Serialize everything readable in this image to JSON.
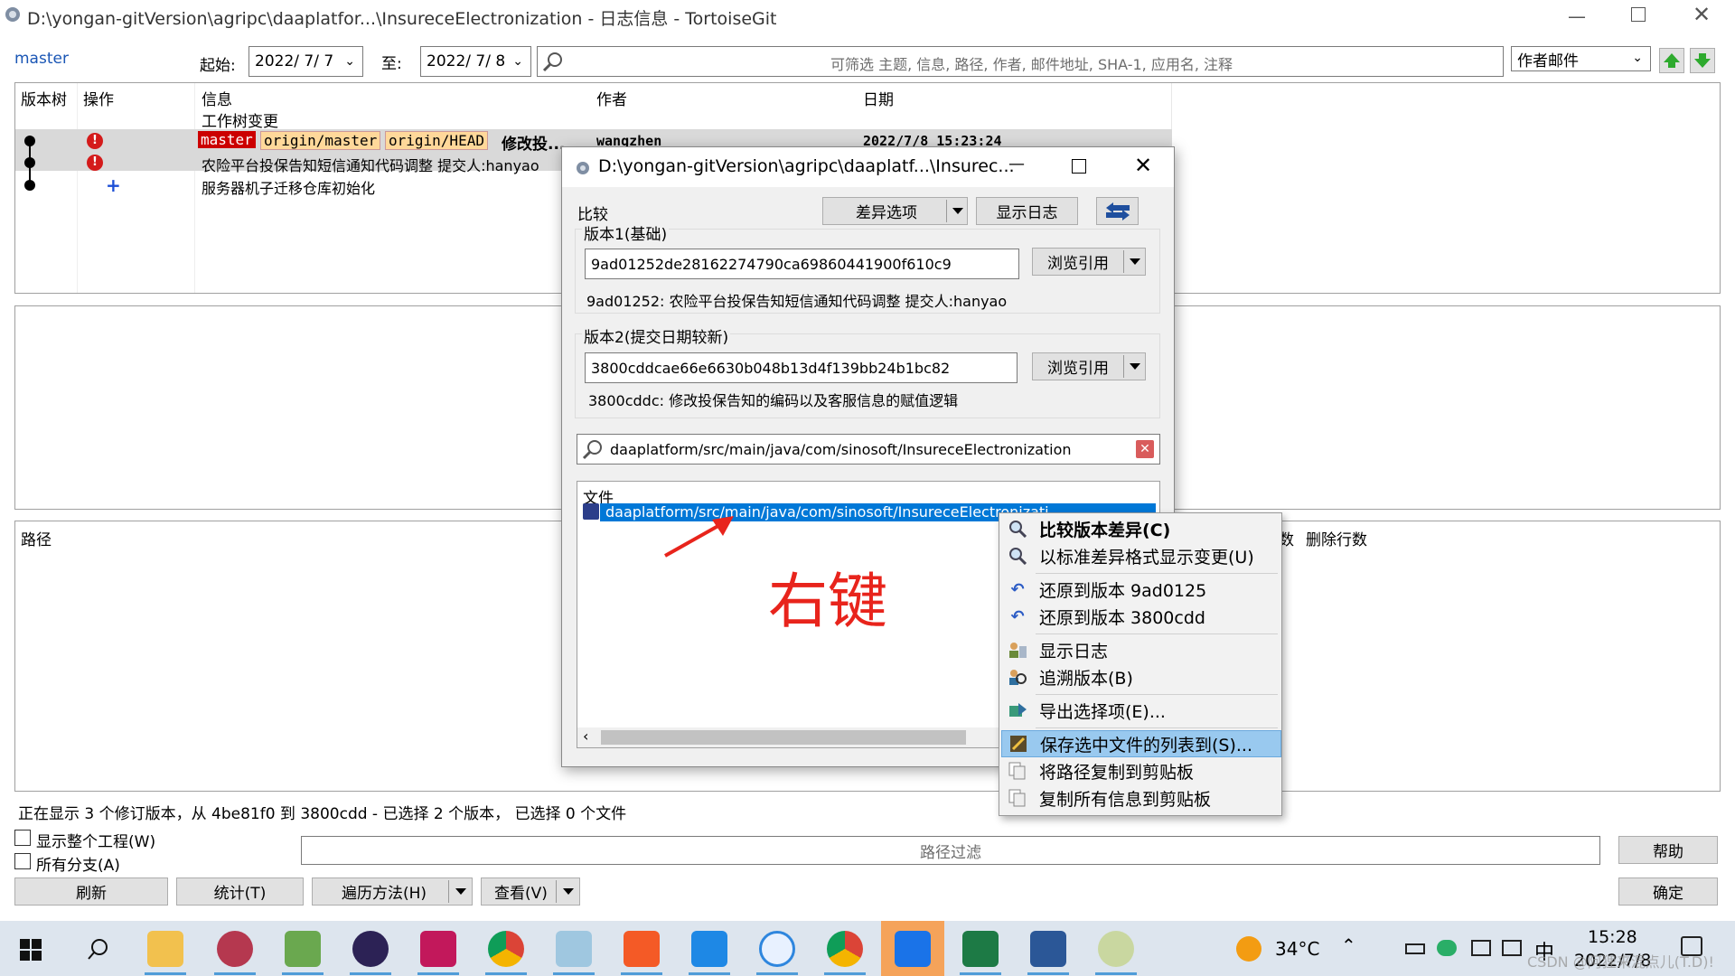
{
  "window": {
    "title": "D:\\yongan-gitVersion\\agripc\\daaplatfor...\\InsureceElectronization - 日志信息 - TortoiseGit"
  },
  "filter_bar": {
    "branch": "master",
    "from_label": "起始:",
    "from_date": "2022/ 7/ 7",
    "to_label": "至:",
    "to_date": "2022/ 7/ 8",
    "search_placeholder": "可筛选 主题, 信息, 路径, 作者, 邮件地址, SHA-1, 应用名, 注释",
    "author_filter": "作者邮件"
  },
  "log_table": {
    "headers": [
      "版本树",
      "操作",
      "信息",
      "作者",
      "日期"
    ],
    "working_tree_label": "工作树变更",
    "rows": [
      {
        "refs": [
          "master",
          "origin/master",
          "origin/HEAD"
        ],
        "message": "修改投...",
        "author": "wangzhen",
        "date": "2022/7/8 15:23:24"
      },
      {
        "refs": [],
        "message": "农险平台投保告知短信通知代码调整 提交人:hanyao",
        "author": "",
        "date": ""
      },
      {
        "refs": [],
        "message": "服务器机子迁移仓库初始化",
        "author": "",
        "date": ""
      }
    ]
  },
  "files_panel": {
    "headers": [
      "路径",
      "数",
      "删除行数"
    ]
  },
  "status": {
    "text": "正在显示 3 个修订版本，从 4be81f0 到 3800cdd - 已选择 2 个版本， 已选择 0 个文件"
  },
  "bottom": {
    "show_whole_project": "显示整个工程(W)",
    "all_branches": "所有分支(A)",
    "path_filter_placeholder": "路径过滤",
    "help": "帮助",
    "ok": "确定",
    "refresh": "刷新",
    "stats": "统计(T)",
    "walk_method": "遍历方法(H)",
    "view": "查看(V)"
  },
  "dialog": {
    "title": "D:\\yongan-gitVersion\\agripc\\daaplatf...\\Insurec...",
    "compare_label": "比较",
    "diff_options": "差异选项",
    "show_log": "显示日志",
    "rev1_label": "版本1(基础)",
    "rev1_hash": "9ad01252de28162274790ca69860441900f610c9",
    "rev1_desc": "9ad01252: 农险平台投保告知短信通知代码调整 提交人:hanyao",
    "browse_ref": "浏览引用",
    "rev2_label": "版本2(提交日期较新)",
    "rev2_hash": "3800cddcae66e6630b048b13d4f139bb24b1bc82",
    "rev2_desc": "3800cddc: 修改投保告知的编码以及客服信息的赋值逻辑",
    "path_filter": "daaplatform/src/main/java/com/sinosoft/InsureceElectronization",
    "files_header": "文件",
    "selected_file": "daaplatform/src/main/java/com/sinosoft/InsureceElectronizati"
  },
  "annotation": {
    "text": "右键",
    "color": "#e8241c"
  },
  "context_menu": {
    "items": [
      {
        "label": "比较版本差异(C)",
        "icon": "magnifier-icon",
        "bold": true
      },
      {
        "label": "以标准差异格式显示变更(U)",
        "icon": "magnifier-icon"
      },
      {
        "label": "还原到版本 9ad0125",
        "icon": "revert-icon"
      },
      {
        "label": "还原到版本 3800cdd",
        "icon": "revert-icon"
      },
      {
        "label": "显示日志",
        "icon": "log-icon"
      },
      {
        "label": "追溯版本(B)",
        "icon": "blame-icon"
      },
      {
        "label": "导出选择项(E)...",
        "icon": "export-icon"
      },
      {
        "label": "保存选中文件的列表到(S)...",
        "icon": "save-icon"
      },
      {
        "label": "将路径复制到剪贴板",
        "icon": "copy-icon"
      },
      {
        "label": "复制所有信息到剪贴板",
        "icon": "copy-icon"
      }
    ]
  },
  "taskbar": {
    "temperature": "34°C",
    "ime": "中",
    "time": "15:28",
    "date": "2022/7/8",
    "watermark": "CSDN @阿狸来混点儿(T.D)!"
  },
  "colors": {
    "accent": "#0078d7",
    "selection": "#3399ff",
    "ref_red": "#cc0000",
    "ref_orange": "#ffd89a",
    "taskbar_bg": "#dde5ee"
  }
}
